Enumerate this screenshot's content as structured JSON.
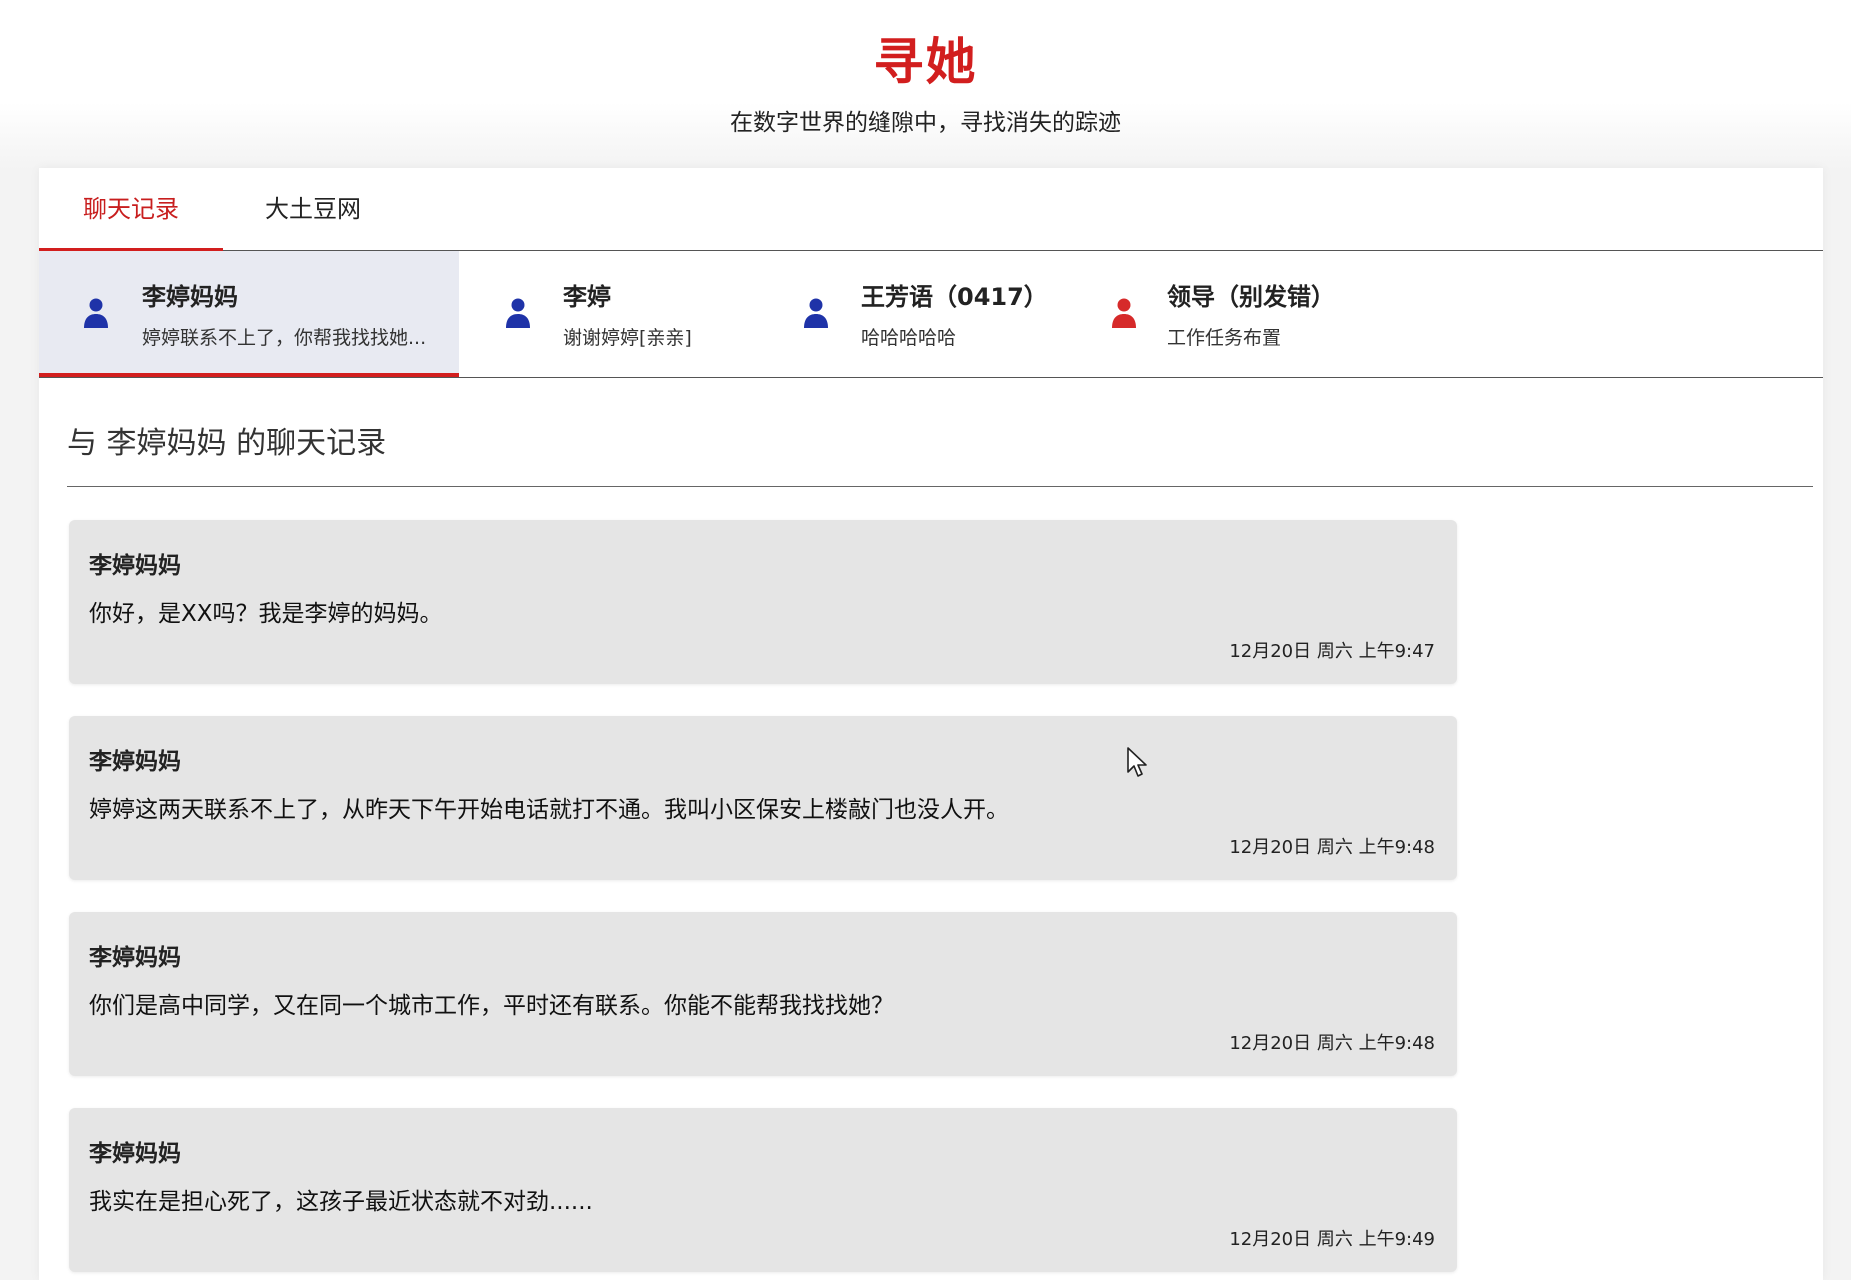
{
  "header": {
    "title": "寻她",
    "subtitle": "在数字世界的缝隙中，寻找消失的踪迹"
  },
  "colors": {
    "accent": "#d21e1e",
    "avatar_blue": "#1f33a8",
    "avatar_red": "#d62a2a",
    "active_contact_bg": "#e8eaf2",
    "message_bg": "#e5e5e5"
  },
  "tabs": [
    {
      "label": "聊天记录",
      "active": true
    },
    {
      "label": "大土豆网",
      "active": false
    }
  ],
  "contacts": [
    {
      "name": "李婷妈妈",
      "preview": "婷婷联系不上了，你帮我找找她...",
      "avatar_icon": "user-icon",
      "avatar_color": "blue",
      "active": true
    },
    {
      "name": "李婷",
      "preview": "谢谢婷婷[亲亲]",
      "avatar_icon": "user-icon",
      "avatar_color": "blue",
      "active": false
    },
    {
      "name": "王芳语（0417）",
      "preview": "哈哈哈哈哈",
      "avatar_icon": "user-icon",
      "avatar_color": "blue",
      "active": false
    },
    {
      "name": "领导（别发错）",
      "preview": "工作任务布置",
      "avatar_icon": "user-icon",
      "avatar_color": "red",
      "active": false
    }
  ],
  "chat": {
    "title": "与 李婷妈妈 的聊天记录",
    "messages": [
      {
        "sender": "李婷妈妈",
        "text": "你好，是XX吗？我是李婷的妈妈。",
        "time": "12月20日 周六 上午9:47"
      },
      {
        "sender": "李婷妈妈",
        "text": "婷婷这两天联系不上了，从昨天下午开始电话就打不通。我叫小区保安上楼敲门也没人开。",
        "time": "12月20日 周六 上午9:48"
      },
      {
        "sender": "李婷妈妈",
        "text": "你们是高中同学，又在同一个城市工作，平时还有联系。你能不能帮我找找她？",
        "time": "12月20日 周六 上午9:48"
      },
      {
        "sender": "李婷妈妈",
        "text": "我实在是担心死了，这孩子最近状态就不对劲......",
        "time": "12月20日 周六 上午9:49"
      }
    ]
  }
}
